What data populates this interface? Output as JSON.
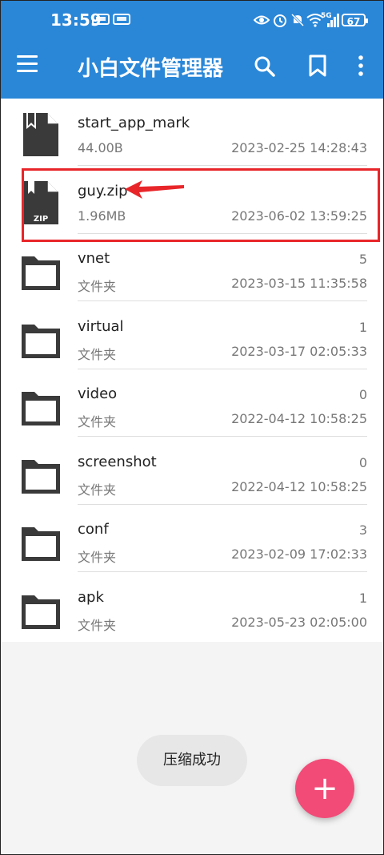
{
  "status": {
    "time": "13:59",
    "network_5g": "5G",
    "battery": "67"
  },
  "toolbar": {
    "title": "小白文件管理器"
  },
  "files": [
    {
      "name": "start_app_mark",
      "sub": "44.00B",
      "count": "",
      "date": "2023-02-25 14:28:43",
      "kind": "file"
    },
    {
      "name": "guy.zip",
      "sub": "1.96MB",
      "count": "",
      "date": "2023-06-02 13:59:25",
      "kind": "zip",
      "zip_label": "ZIP"
    },
    {
      "name": "vnet",
      "sub": "文件夹",
      "count": "5",
      "date": "2023-03-15 11:35:58",
      "kind": "folder"
    },
    {
      "name": "virtual",
      "sub": "文件夹",
      "count": "1",
      "date": "2023-03-17 02:05:33",
      "kind": "folder"
    },
    {
      "name": "video",
      "sub": "文件夹",
      "count": "0",
      "date": "2022-04-12 10:58:25",
      "kind": "folder"
    },
    {
      "name": "screenshot",
      "sub": "文件夹",
      "count": "0",
      "date": "2022-04-12 10:58:25",
      "kind": "folder"
    },
    {
      "name": "conf",
      "sub": "文件夹",
      "count": "3",
      "date": "2023-02-09 17:02:33",
      "kind": "folder"
    },
    {
      "name": "apk",
      "sub": "文件夹",
      "count": "1",
      "date": "2023-05-23 02:05:00",
      "kind": "folder"
    }
  ],
  "toast": {
    "text": "压缩成功"
  },
  "fab": {
    "label": "+"
  },
  "colors": {
    "toolbar_blue": "#2a87d8",
    "fab_pink": "#f24b78",
    "highlight_red": "#e8262a"
  }
}
